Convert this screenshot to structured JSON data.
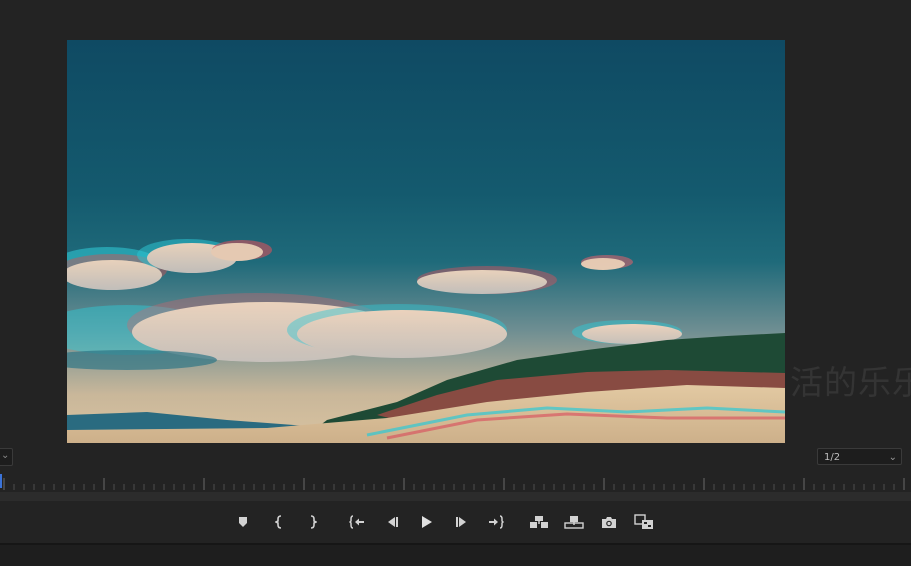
{
  "viewer": {
    "watermark": "活的乐乐"
  },
  "resolution": {
    "value": "1/2"
  },
  "transport": {
    "buttons": [
      {
        "name": "add-marker-button",
        "icon": "marker-icon"
      },
      {
        "name": "mark-in-button",
        "icon": "mark-in-icon"
      },
      {
        "name": "mark-out-button",
        "icon": "mark-out-icon"
      },
      {
        "name": "go-to-in-button",
        "icon": "go-to-in-icon"
      },
      {
        "name": "step-back-button",
        "icon": "step-back-icon"
      },
      {
        "name": "play-button",
        "icon": "play-icon"
      },
      {
        "name": "step-forward-button",
        "icon": "step-forward-icon"
      },
      {
        "name": "go-to-out-button",
        "icon": "go-to-out-icon"
      },
      {
        "name": "insert-button",
        "icon": "insert-icon"
      },
      {
        "name": "overwrite-button",
        "icon": "overwrite-icon"
      },
      {
        "name": "export-frame-button",
        "icon": "camera-icon"
      },
      {
        "name": "comparison-view-button",
        "icon": "comparison-icon"
      }
    ]
  }
}
